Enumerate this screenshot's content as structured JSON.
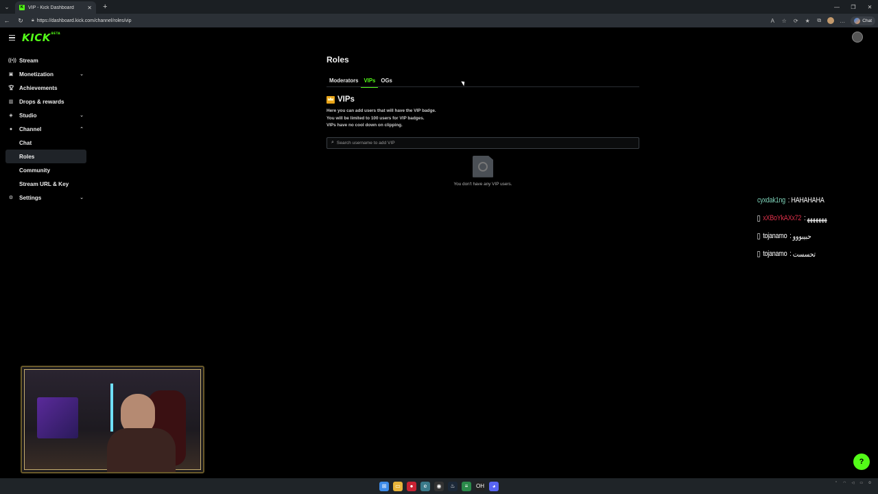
{
  "browser": {
    "tab_title": "VIP - Kick Dashboard",
    "tab_favicon": "K",
    "url": "https://dashboard.kick.com/channel/roles/vip",
    "chat_button": "Chat"
  },
  "header": {
    "logo": "KICK",
    "logo_beta": "BETA"
  },
  "sidebar": {
    "items": [
      {
        "label": "Stream",
        "icon": "broadcast-icon"
      },
      {
        "label": "Monetization",
        "icon": "money-icon"
      },
      {
        "label": "Achievements",
        "icon": "trophy-icon"
      },
      {
        "label": "Drops & rewards",
        "icon": "gift-icon"
      },
      {
        "label": "Studio",
        "icon": "studio-icon"
      },
      {
        "label": "Channel",
        "icon": "channel-icon"
      },
      {
        "label": "Chat"
      },
      {
        "label": "Roles"
      },
      {
        "label": "Community"
      },
      {
        "label": "Stream URL & Key"
      },
      {
        "label": "Settings",
        "icon": "gear-icon"
      }
    ]
  },
  "main": {
    "title": "Roles",
    "tabs": [
      "Moderators",
      "VIPs",
      "OGs"
    ],
    "active_tab": "VIPs",
    "section_title": "VIPs",
    "description": [
      "Here you can add users that will have the VIP badge.",
      "You will be limited to 100 users for VIP badges.",
      "VIPs have no cool down on clipping."
    ],
    "search_placeholder": "Search username to add VIP",
    "empty_text": "You don't have any VIP users."
  },
  "chat_overlay": [
    {
      "user": "cyxdak1ng",
      "user_color": "#7ed3b9",
      "message": "HAHAHAHA",
      "badge": false
    },
    {
      "user": "xXBoYkAXx72",
      "user_color": "#e0314b",
      "message": "ﻬﻬﻬﻬﻬﻬﻬ",
      "badge": true
    },
    {
      "user": "tojanamo",
      "user_color": "#ffffff",
      "message": "حبيبووو",
      "badge": true
    },
    {
      "user": "tojanamo",
      "user_color": "#ffffff",
      "message": "تحسست",
      "badge": true
    }
  ],
  "colors": {
    "accent": "#53fc18",
    "background": "#000000"
  }
}
